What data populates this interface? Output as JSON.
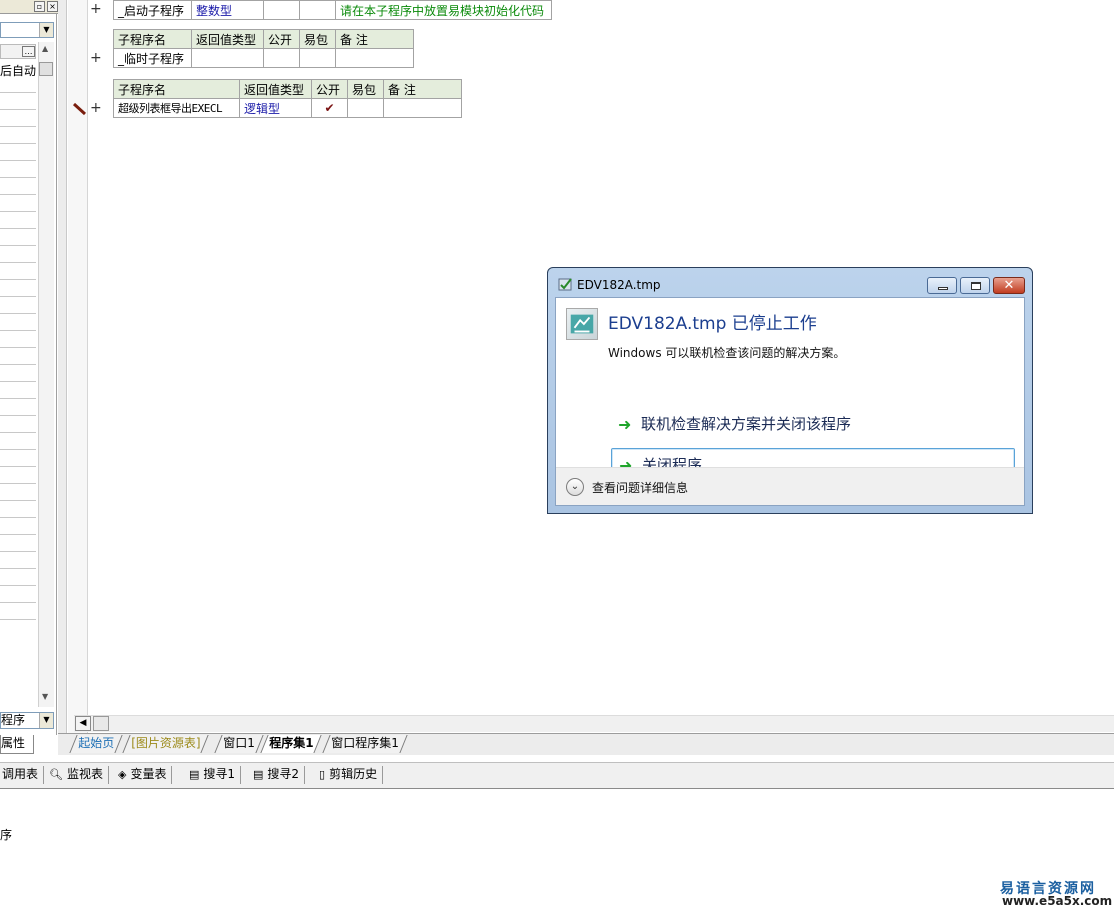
{
  "left_panel": {
    "label_fragment": "后自动",
    "bottom_combo": "程序",
    "bottom_tab": "属性"
  },
  "table1": {
    "row": {
      "name": "_启动子程序",
      "type": "整数型",
      "comment": "请在本子程序中放置易模块初始化代码"
    }
  },
  "table2": {
    "headers": [
      "子程序名",
      "返回值类型",
      "公开",
      "易包",
      "备 注"
    ],
    "row": {
      "name": "_临时子程序"
    }
  },
  "table3": {
    "headers": [
      "子程序名",
      "返回值类型",
      "公开",
      "易包",
      "备 注"
    ],
    "row": {
      "name": "超级列表框导出EXECL",
      "type": "逻辑型",
      "public_mark": "✔"
    }
  },
  "gutter": {
    "plus": "+"
  },
  "dialog": {
    "window_title": "EDV182A.tmp",
    "heading": "EDV182A.tmp 已停止工作",
    "description": "Windows 可以联机检查该问题的解决方案。",
    "option_online": "联机检查解决方案并关闭该程序",
    "option_close": "关闭程序",
    "details": "查看问题详细信息",
    "close_glyph": "✕"
  },
  "tabs": [
    "起始页",
    "[图片资源表]",
    "窗口1",
    "程序集1",
    "窗口程序集1"
  ],
  "active_tab": "程序集1",
  "bottom_toolbar": [
    "调用表",
    "监视表",
    "变量表",
    "搜寻1",
    "搜寻2",
    "剪辑历史"
  ],
  "output_text": "序",
  "watermark": {
    "line1": "易语言资源网",
    "line2": "www.e5a5x.com"
  },
  "colors": {
    "table_header": "#e4eddc",
    "type_text": "#1a1aa8",
    "comment_text": "#0a8a0a",
    "dialog_heading": "#1b3e8f",
    "arrow": "#1fa52b"
  }
}
